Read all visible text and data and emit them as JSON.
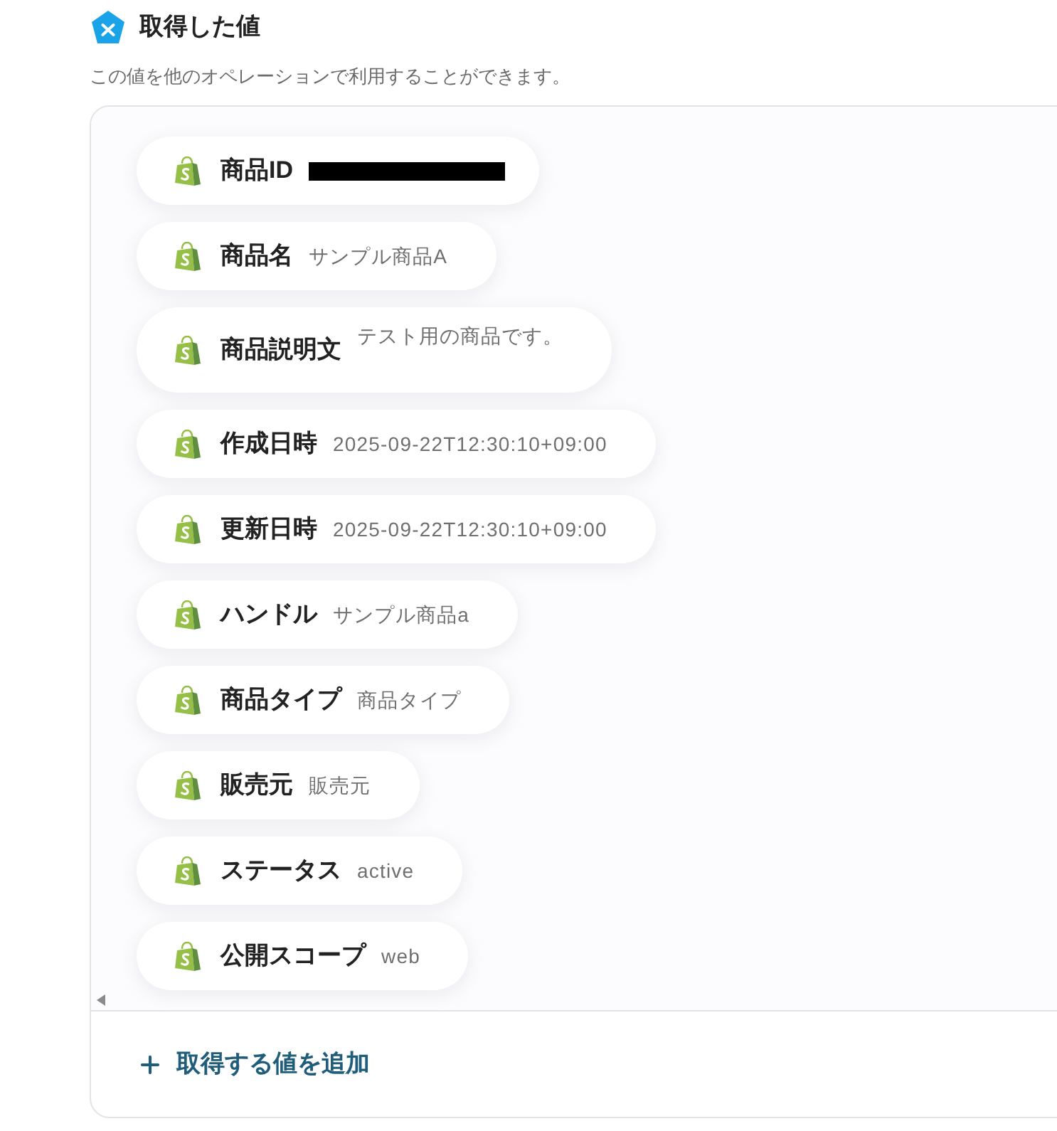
{
  "header": {
    "title": "取得した値",
    "description": "この値を他のオペレーションで利用することができます。"
  },
  "values": [
    {
      "kind": "redacted",
      "label": "商品ID"
    },
    {
      "kind": "text",
      "label": "商品名",
      "value": "サンプル商品A"
    },
    {
      "kind": "multiline",
      "label": "商品説明文",
      "value": "テスト用の商品です。"
    },
    {
      "kind": "text",
      "label": "作成日時",
      "value": "2025-09-22T12:30:10+09:00"
    },
    {
      "kind": "text",
      "label": "更新日時",
      "value": "2025-09-22T12:30:10+09:00"
    },
    {
      "kind": "text",
      "label": "ハンドル",
      "value": "サンプル商品a"
    },
    {
      "kind": "text",
      "label": "商品タイプ",
      "value": "商品タイプ"
    },
    {
      "kind": "text",
      "label": "販売元",
      "value": "販売元"
    },
    {
      "kind": "text",
      "label": "ステータス",
      "value": "active"
    },
    {
      "kind": "text",
      "label": "公開スコープ",
      "value": "web"
    }
  ],
  "add_button": {
    "label": "取得する値を追加"
  }
}
